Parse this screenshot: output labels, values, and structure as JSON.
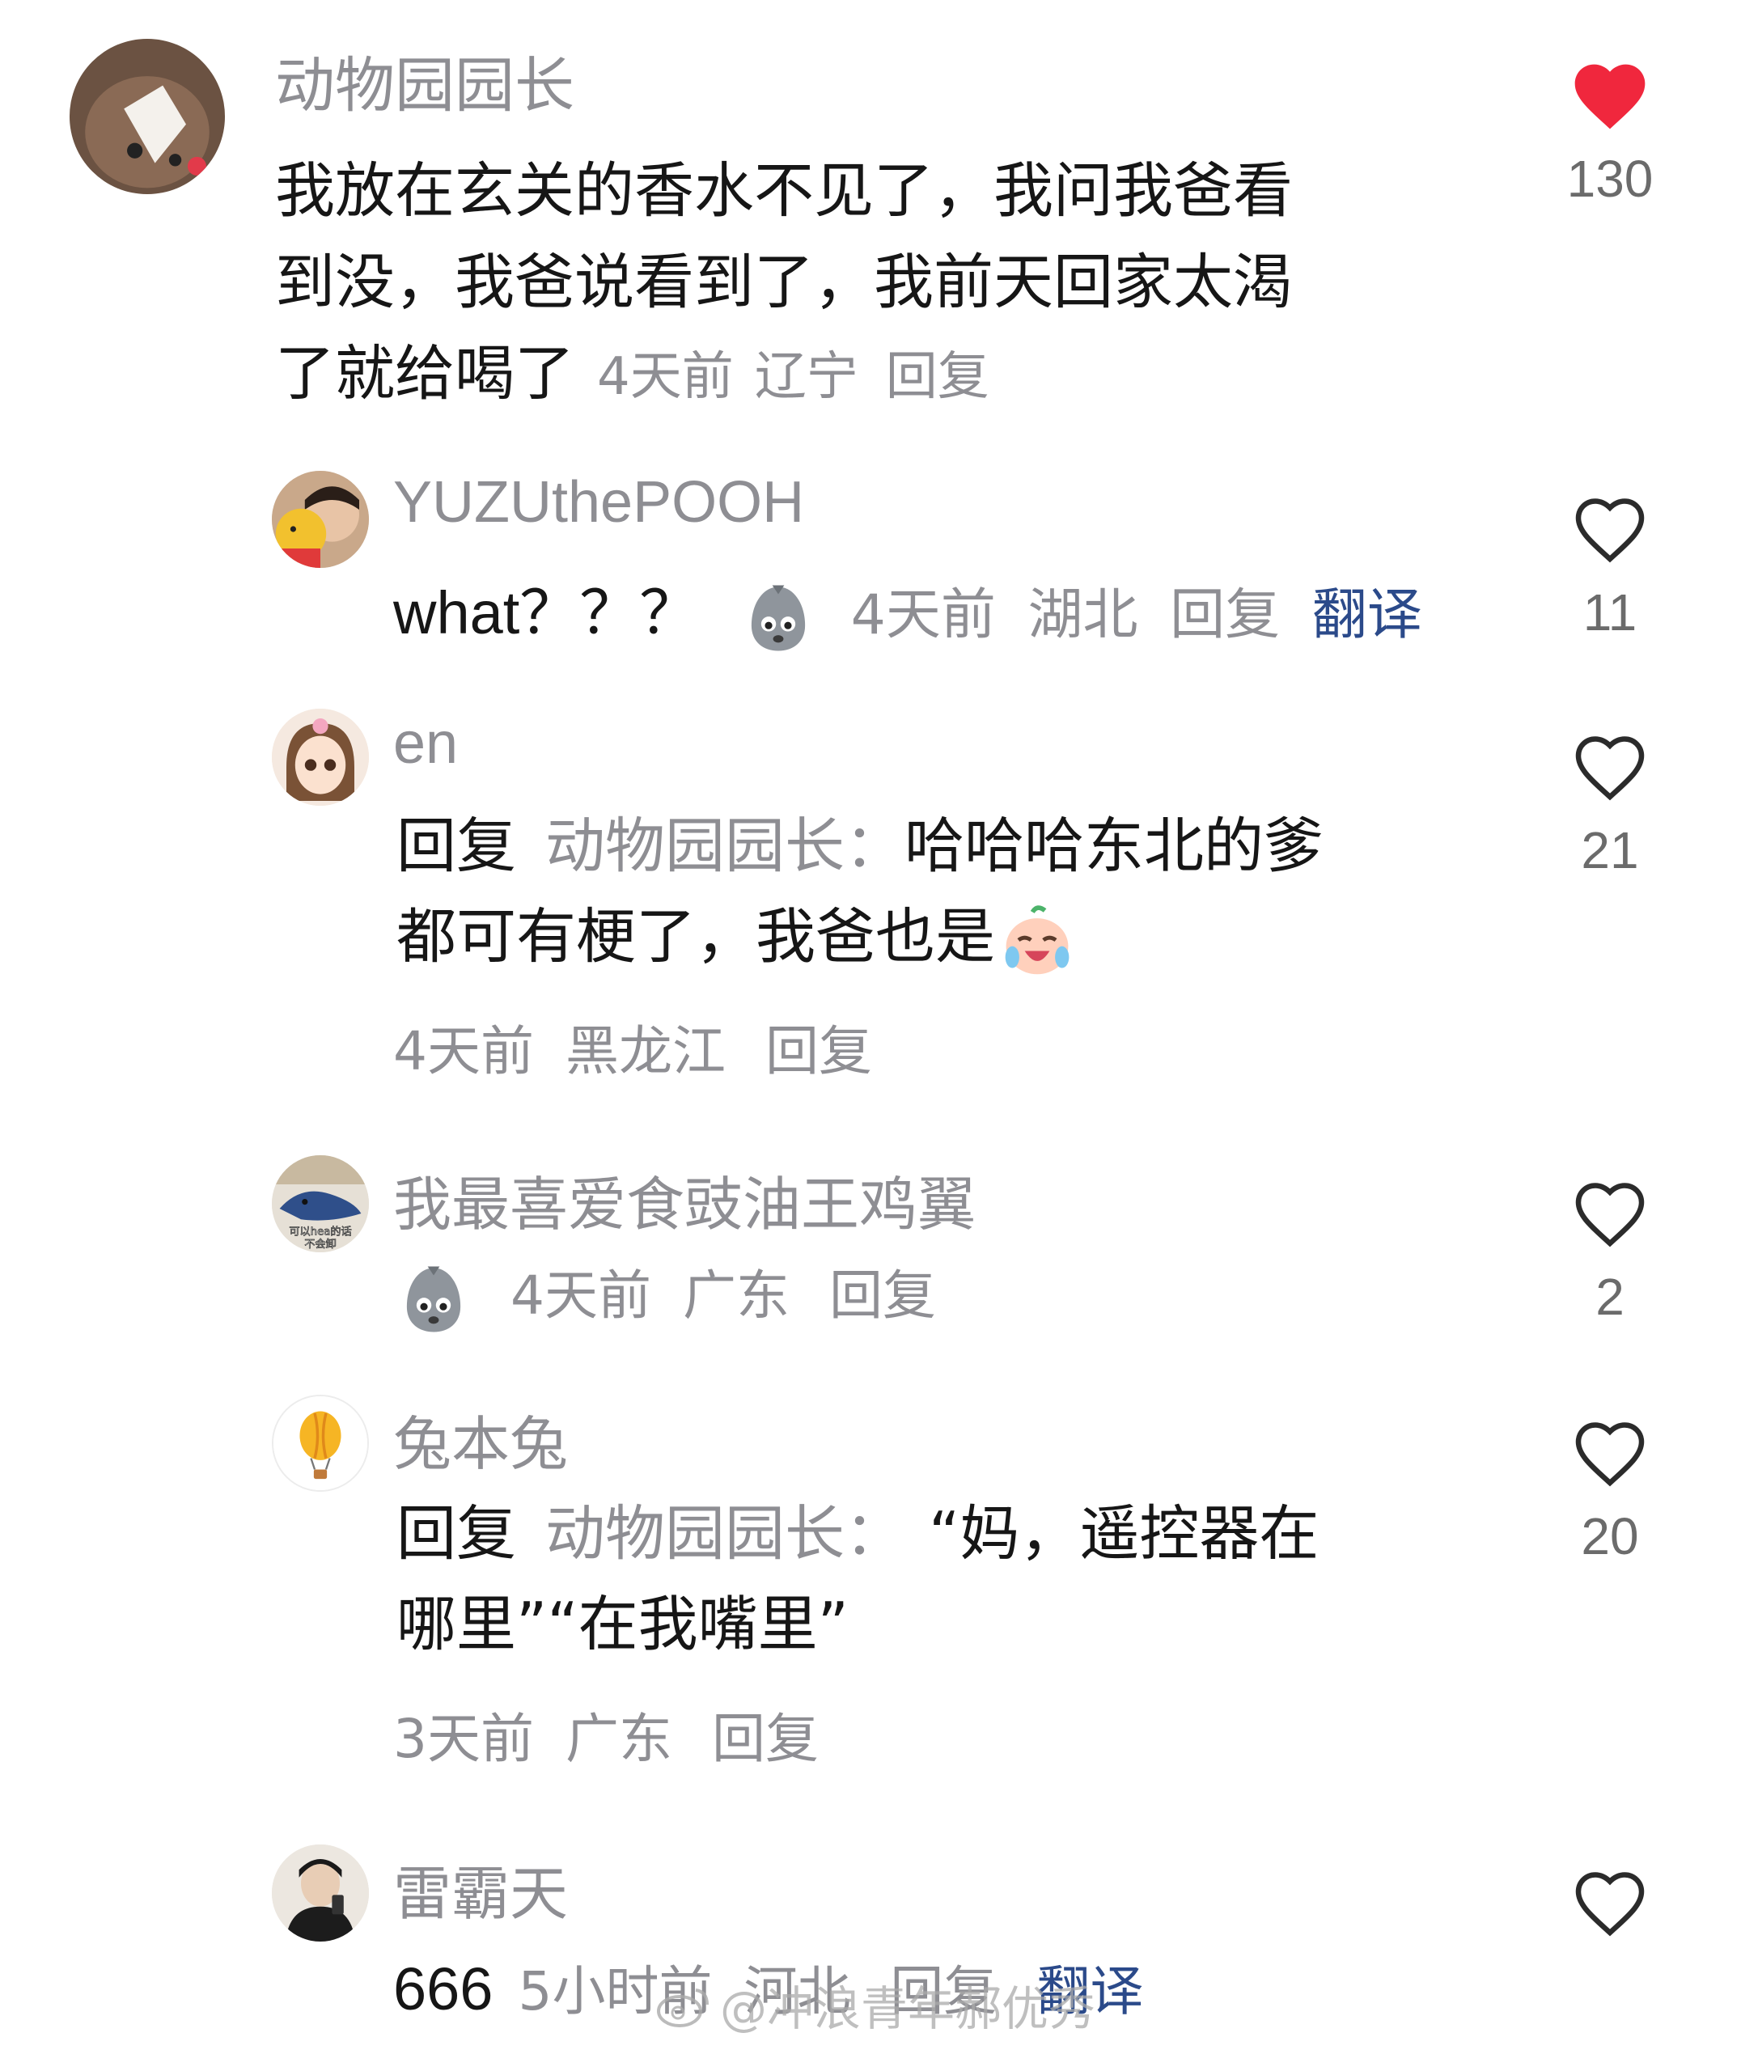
{
  "colors": {
    "accent_like": "#f0273d",
    "text_main": "#161616",
    "text_muted": "#8e8e93",
    "translate": "#2b4a8a"
  },
  "comments": [
    {
      "username": "动物园园长",
      "lines": [
        "我放在玄关的香水不见了，我问我爸看",
        "到没，我爸说看到了，我前天回家太渴",
        "了就给喝了"
      ],
      "time": "4天前",
      "location": "辽宁",
      "reply": "回复",
      "likes": "130",
      "liked": true
    },
    {
      "username": "YUZUthePOOH",
      "text": "what？？？",
      "emoji": "sticker-face",
      "time": "4天前",
      "location": "湖北",
      "reply": "回复",
      "translate": "翻译",
      "likes": "11"
    },
    {
      "username": "en",
      "reply_prefix": "回复",
      "mention": "动物园园长：",
      "line1": "哈哈哈东北的爹",
      "line2": "都可有梗了，我爸也是",
      "emoji": "crying-laughing-sticker",
      "time": "4天前",
      "location": "黑龙江",
      "reply": "回复",
      "likes": "21"
    },
    {
      "username": "我最喜爱食豉油王鸡翼",
      "emoji": "sticker-face",
      "time": "4天前",
      "location": "广东",
      "reply": "回复",
      "likes": "2",
      "avatar_text": [
        "可以hea的话",
        "不会卸"
      ]
    },
    {
      "username": "兔本兔",
      "reply_prefix": "回复",
      "mention": "动物园园长：",
      "line1": "“妈，遥控器在",
      "line2": "哪里”“在我嘴里”",
      "time": "3天前",
      "location": "广东",
      "reply": "回复",
      "likes": "20"
    },
    {
      "username": "雷霸天",
      "text": "666",
      "time": "5小时前",
      "location": "河北",
      "reply": "回复",
      "translate": "翻译",
      "likes": ""
    }
  ],
  "watermark": "@冲浪青年郝优秀"
}
